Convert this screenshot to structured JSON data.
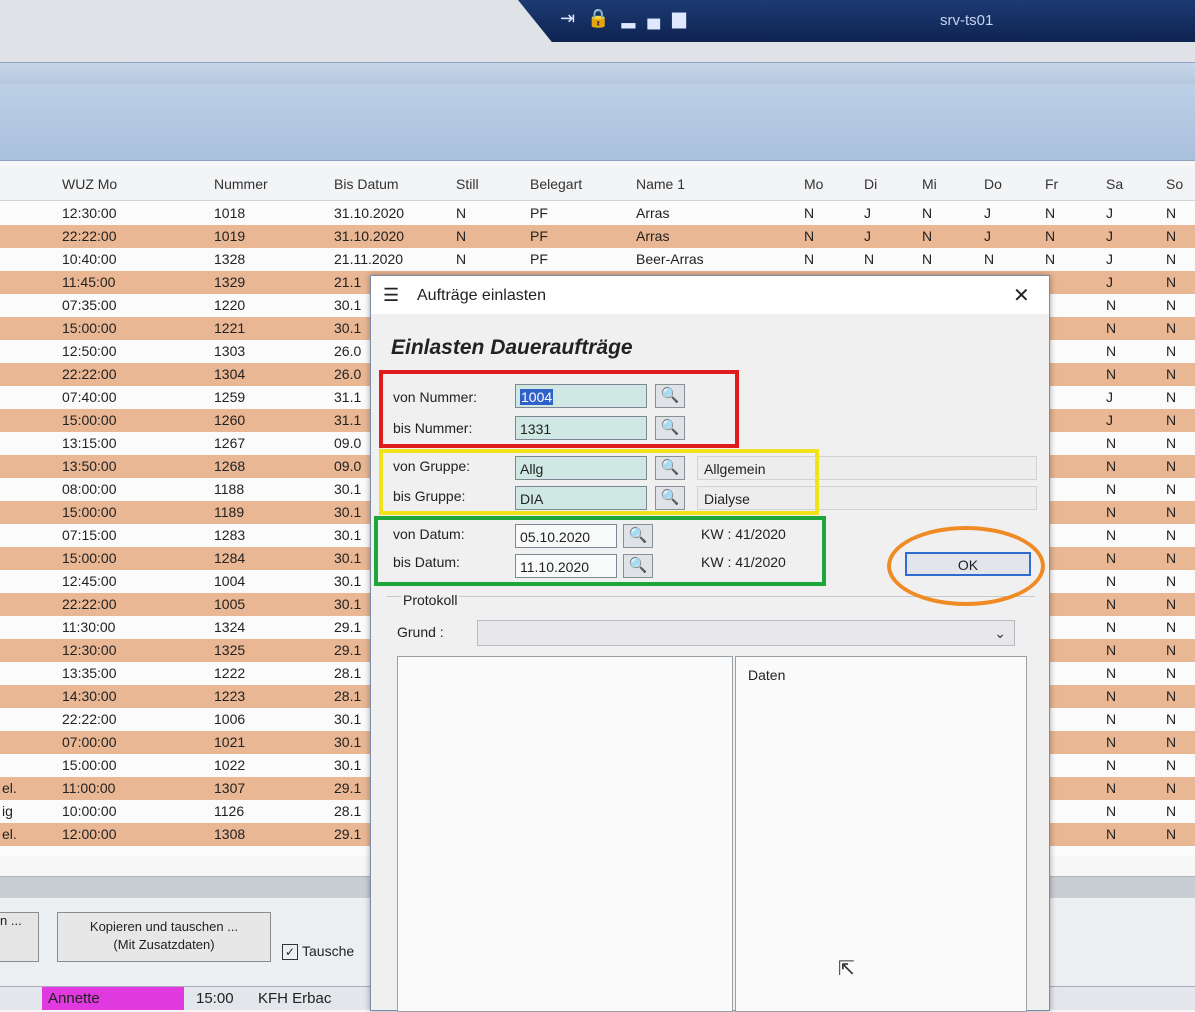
{
  "session": {
    "server": "srv-ts01",
    "icons": [
      "pin-icon",
      "lock-icon",
      "signal-icon"
    ]
  },
  "grid": {
    "columns": [
      "WUZ Mo",
      "Nummer",
      "Bis Datum",
      "Still",
      "Belegart",
      "Name 1",
      "Mo",
      "Di",
      "Mi",
      "Do",
      "Fr",
      "Sa",
      "So"
    ],
    "rows": [
      {
        "prefix": "",
        "wuz": "12:30:00",
        "nr": "1018",
        "bis": "31.10.2020",
        "still": "N",
        "beleg": "PF",
        "name": "Arras",
        "mo": "N",
        "di": "J",
        "mi": "N",
        "do": "J",
        "fr": "N",
        "sa": "J",
        "so": "N"
      },
      {
        "prefix": "",
        "wuz": "22:22:00",
        "nr": "1019",
        "bis": "31.10.2020",
        "still": "N",
        "beleg": "PF",
        "name": "Arras",
        "mo": "N",
        "di": "J",
        "mi": "N",
        "do": "J",
        "fr": "N",
        "sa": "J",
        "so": "N"
      },
      {
        "prefix": "",
        "wuz": "10:40:00",
        "nr": "1328",
        "bis": "21.11.2020",
        "still": "N",
        "beleg": "PF",
        "name": "Beer-Arras",
        "mo": "N",
        "di": "N",
        "mi": "N",
        "do": "N",
        "fr": "N",
        "sa": "J",
        "so": "N"
      },
      {
        "prefix": "",
        "wuz": "11:45:00",
        "nr": "1329",
        "bis": "21.1",
        "still": "",
        "beleg": "",
        "name": "",
        "mo": "",
        "di": "",
        "mi": "",
        "do": "",
        "fr": "",
        "sa": "J",
        "so": "N"
      },
      {
        "prefix": "",
        "wuz": "07:35:00",
        "nr": "1220",
        "bis": "30.1",
        "still": "",
        "beleg": "",
        "name": "",
        "mo": "",
        "di": "",
        "mi": "",
        "do": "",
        "fr": "",
        "sa": "N",
        "so": "N"
      },
      {
        "prefix": "",
        "wuz": "15:00:00",
        "nr": "1221",
        "bis": "30.1",
        "still": "",
        "beleg": "",
        "name": "",
        "mo": "",
        "di": "",
        "mi": "",
        "do": "",
        "fr": "",
        "sa": "N",
        "so": "N"
      },
      {
        "prefix": "",
        "wuz": "12:50:00",
        "nr": "1303",
        "bis": "26.0",
        "still": "",
        "beleg": "",
        "name": "",
        "mo": "",
        "di": "",
        "mi": "",
        "do": "",
        "fr": "",
        "sa": "N",
        "so": "N"
      },
      {
        "prefix": "",
        "wuz": "22:22:00",
        "nr": "1304",
        "bis": "26.0",
        "still": "",
        "beleg": "",
        "name": "",
        "mo": "",
        "di": "",
        "mi": "",
        "do": "",
        "fr": "",
        "sa": "N",
        "so": "N"
      },
      {
        "prefix": "",
        "wuz": "07:40:00",
        "nr": "1259",
        "bis": "31.1",
        "still": "",
        "beleg": "",
        "name": "",
        "mo": "",
        "di": "",
        "mi": "",
        "do": "",
        "fr": "",
        "sa": "J",
        "so": "N"
      },
      {
        "prefix": "",
        "wuz": "15:00:00",
        "nr": "1260",
        "bis": "31.1",
        "still": "",
        "beleg": "",
        "name": "",
        "mo": "",
        "di": "",
        "mi": "",
        "do": "",
        "fr": "",
        "sa": "J",
        "so": "N"
      },
      {
        "prefix": "",
        "wuz": "13:15:00",
        "nr": "1267",
        "bis": "09.0",
        "still": "",
        "beleg": "",
        "name": "",
        "mo": "",
        "di": "",
        "mi": "",
        "do": "",
        "fr": "",
        "sa": "N",
        "so": "N"
      },
      {
        "prefix": "",
        "wuz": "13:50:00",
        "nr": "1268",
        "bis": "09.0",
        "still": "",
        "beleg": "",
        "name": "",
        "mo": "",
        "di": "",
        "mi": "",
        "do": "",
        "fr": "",
        "sa": "N",
        "so": "N"
      },
      {
        "prefix": "",
        "wuz": "08:00:00",
        "nr": "1188",
        "bis": "30.1",
        "still": "",
        "beleg": "",
        "name": "",
        "mo": "",
        "di": "",
        "mi": "",
        "do": "",
        "fr": "",
        "sa": "N",
        "so": "N"
      },
      {
        "prefix": "",
        "wuz": "15:00:00",
        "nr": "1189",
        "bis": "30.1",
        "still": "",
        "beleg": "",
        "name": "",
        "mo": "",
        "di": "",
        "mi": "",
        "do": "",
        "fr": "",
        "sa": "N",
        "so": "N"
      },
      {
        "prefix": "",
        "wuz": "07:15:00",
        "nr": "1283",
        "bis": "30.1",
        "still": "",
        "beleg": "",
        "name": "",
        "mo": "",
        "di": "",
        "mi": "",
        "do": "",
        "fr": "",
        "sa": "N",
        "so": "N"
      },
      {
        "prefix": "",
        "wuz": "15:00:00",
        "nr": "1284",
        "bis": "30.1",
        "still": "",
        "beleg": "",
        "name": "",
        "mo": "",
        "di": "",
        "mi": "",
        "do": "",
        "fr": "",
        "sa": "N",
        "so": "N"
      },
      {
        "prefix": "",
        "wuz": "12:45:00",
        "nr": "1004",
        "bis": "30.1",
        "still": "",
        "beleg": "",
        "name": "",
        "mo": "",
        "di": "",
        "mi": "",
        "do": "",
        "fr": "",
        "sa": "N",
        "so": "N"
      },
      {
        "prefix": "",
        "wuz": "22:22:00",
        "nr": "1005",
        "bis": "30.1",
        "still": "",
        "beleg": "",
        "name": "",
        "mo": "",
        "di": "",
        "mi": "",
        "do": "",
        "fr": "",
        "sa": "N",
        "so": "N"
      },
      {
        "prefix": "",
        "wuz": "11:30:00",
        "nr": "1324",
        "bis": "29.1",
        "still": "",
        "beleg": "",
        "name": "",
        "mo": "",
        "di": "",
        "mi": "",
        "do": "",
        "fr": "",
        "sa": "N",
        "so": "N"
      },
      {
        "prefix": "",
        "wuz": "12:30:00",
        "nr": "1325",
        "bis": "29.1",
        "still": "",
        "beleg": "",
        "name": "",
        "mo": "",
        "di": "",
        "mi": "",
        "do": "",
        "fr": "",
        "sa": "N",
        "so": "N"
      },
      {
        "prefix": "",
        "wuz": "13:35:00",
        "nr": "1222",
        "bis": "28.1",
        "still": "",
        "beleg": "",
        "name": "",
        "mo": "",
        "di": "",
        "mi": "",
        "do": "",
        "fr": "",
        "sa": "N",
        "so": "N"
      },
      {
        "prefix": "",
        "wuz": "14:30:00",
        "nr": "1223",
        "bis": "28.1",
        "still": "",
        "beleg": "",
        "name": "",
        "mo": "",
        "di": "",
        "mi": "",
        "do": "",
        "fr": "",
        "sa": "N",
        "so": "N"
      },
      {
        "prefix": "",
        "wuz": "22:22:00",
        "nr": "1006",
        "bis": "30.1",
        "still": "",
        "beleg": "",
        "name": "",
        "mo": "",
        "di": "",
        "mi": "",
        "do": "",
        "fr": "",
        "sa": "N",
        "so": "N"
      },
      {
        "prefix": "",
        "wuz": "07:00:00",
        "nr": "1021",
        "bis": "30.1",
        "still": "",
        "beleg": "",
        "name": "",
        "mo": "",
        "di": "",
        "mi": "",
        "do": "",
        "fr": "",
        "sa": "N",
        "so": "N"
      },
      {
        "prefix": "",
        "wuz": "15:00:00",
        "nr": "1022",
        "bis": "30.1",
        "still": "",
        "beleg": "",
        "name": "",
        "mo": "",
        "di": "",
        "mi": "",
        "do": "",
        "fr": "",
        "sa": "N",
        "so": "N"
      },
      {
        "prefix": "el.",
        "wuz": "11:00:00",
        "nr": "1307",
        "bis": "29.1",
        "still": "",
        "beleg": "",
        "name": "",
        "mo": "",
        "di": "",
        "mi": "",
        "do": "",
        "fr": "",
        "sa": "N",
        "so": "N"
      },
      {
        "prefix": "ig",
        "wuz": "10:00:00",
        "nr": "1126",
        "bis": "28.1",
        "still": "",
        "beleg": "",
        "name": "",
        "mo": "",
        "di": "",
        "mi": "",
        "do": "",
        "fr": "",
        "sa": "N",
        "so": "N"
      },
      {
        "prefix": "el.",
        "wuz": "12:00:00",
        "nr": "1308",
        "bis": "29.1",
        "still": "",
        "beleg": "",
        "name": "",
        "mo": "",
        "di": "",
        "mi": "",
        "do": "",
        "fr": "",
        "sa": "N",
        "so": "N"
      }
    ]
  },
  "buttons": {
    "left_partial": "n ...",
    "copy_line1": "Kopieren und tauschen ...",
    "copy_line2": "(Mit Zusatzdaten)",
    "tausch_label": "Tausche",
    "tausch_checked": "✓"
  },
  "status": {
    "user": "Annette",
    "time": "15:00",
    "location": "KFH Erbac"
  },
  "dialog": {
    "title": "Aufträge einlasten",
    "heading": "Einlasten Daueraufträge",
    "von_nummer_label": "von Nummer:",
    "von_nummer": "1004",
    "bis_nummer_label": "bis Nummer:",
    "bis_nummer": "1331",
    "von_gruppe_label": "von Gruppe:",
    "von_gruppe": "Allg",
    "von_gruppe_desc": "Allgemein",
    "bis_gruppe_label": "bis Gruppe:",
    "bis_gruppe": "DIA",
    "bis_gruppe_desc": "Dialyse",
    "von_datum_label": "von Datum:",
    "von_datum": "05.10.2020",
    "von_kw": "KW : 41/2020",
    "bis_datum_label": "bis Datum:",
    "bis_datum": "11.10.2020",
    "bis_kw": "KW : 41/2020",
    "ok": "OK",
    "protokoll": "Protokoll",
    "grund_label": "Grund :",
    "grund_value": "",
    "daten_label": "Daten"
  },
  "colors": {
    "row_alt": "#e9b793",
    "highlight_red": "#e01b1b",
    "highlight_yellow": "#f2e21a",
    "highlight_green": "#1fa63a",
    "highlight_orange": "#f08a25",
    "user_badge": "#e039e0"
  }
}
